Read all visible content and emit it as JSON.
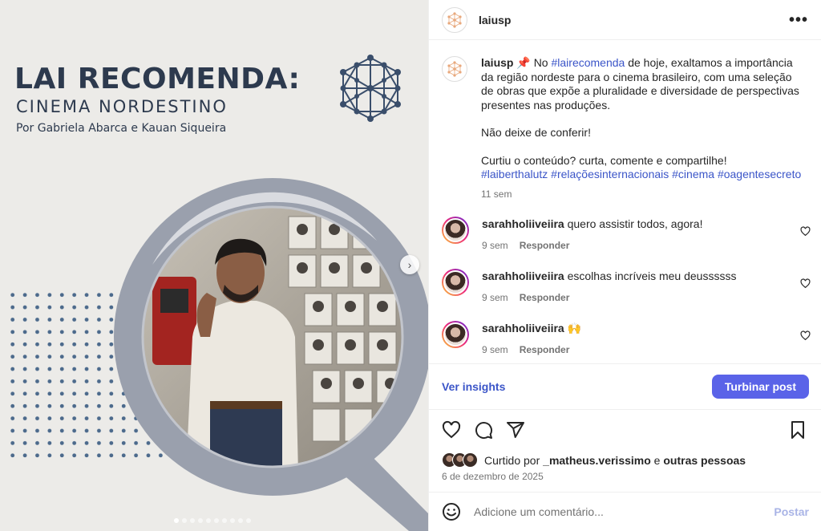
{
  "post_media": {
    "title": "LAI RECOMENDA:",
    "subtitle": "CINEMA NORDESTINO",
    "byline": "Por Gabriela Abarca e Kauan Siqueira",
    "carousel_count": 10,
    "carousel_active_index": 0
  },
  "header": {
    "username": "laiusp",
    "more_icon": "more-horizontal-icon"
  },
  "caption": {
    "username": "laiusp",
    "pin": "📌",
    "intro_before": "No",
    "intro_tag": "#lairecomenda",
    "intro_after": "de hoje, exaltamos a importância da região nordeste para o cinema brasileiro, com uma seleção de obras que expõe a pluralidade e diversidade de perspectivas presentes nas produções.",
    "line2": "Não deixe de conferir!",
    "line3": "Curtiu o conteúdo? curta, comente e compartilhe!",
    "hashtags": "#laiberthalutz #relaçõesinternacionais #cinema #oagentesecreto",
    "time": "11 sem"
  },
  "comments": [
    {
      "user": "sarahholiiveiira",
      "text": "quero assistir todos, agora!",
      "time": "9 sem",
      "reply": "Responder"
    },
    {
      "user": "sarahholiiveiira",
      "text": "escolhas incríveis meu deussssss",
      "time": "9 sem",
      "reply": "Responder"
    },
    {
      "user": "sarahholiiveiira",
      "text": "🙌",
      "time": "9 sem",
      "reply": "Responder"
    }
  ],
  "insights": {
    "link": "Ver insights",
    "boost": "Turbinar post"
  },
  "likes": {
    "prefix": "Curtido por",
    "user": "_matheus.verissimo",
    "mid": "e",
    "others": "outras pessoas"
  },
  "date": "6 de dezembro de 2025",
  "add_comment": {
    "placeholder": "Adicione um comentário...",
    "post": "Postar"
  },
  "colors": {
    "link": "#3b55c8",
    "button": "#5a63e8",
    "navy": "#2d3a4e"
  }
}
